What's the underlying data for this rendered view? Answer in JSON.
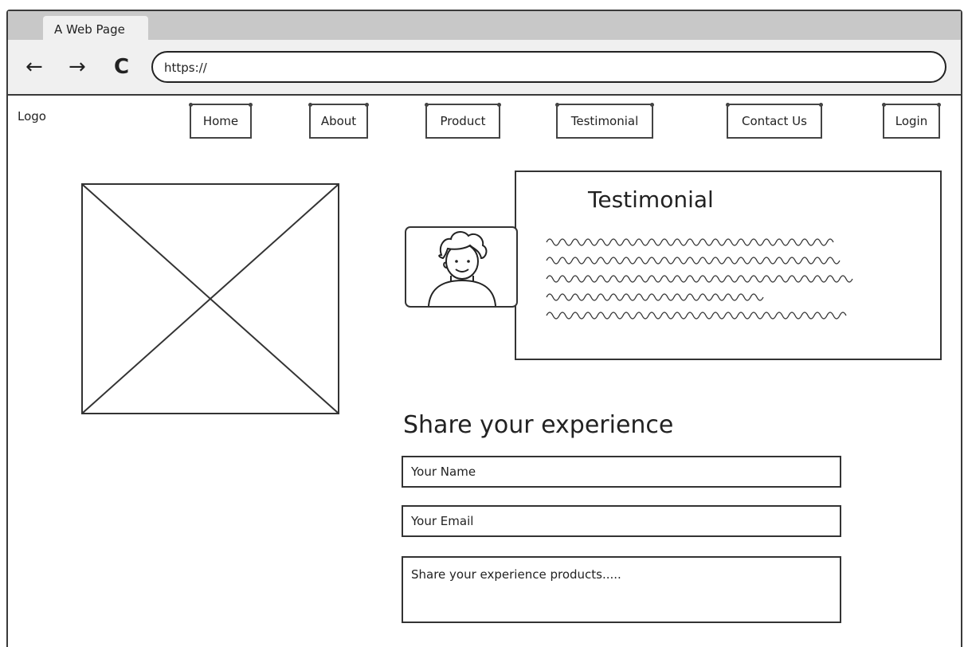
{
  "browser": {
    "tab_title": "A Web Page",
    "url": "https://",
    "back_icon": "←",
    "forward_icon": "→",
    "reload_icon": "C"
  },
  "header": {
    "logo": "Logo",
    "nav": [
      "Home",
      "About",
      "Product",
      "Testimonial",
      "Contact Us"
    ],
    "login": "Login"
  },
  "testimonial": {
    "title": "Testimonial"
  },
  "form": {
    "heading": "Share your experience",
    "name_placeholder": "Your Name",
    "email_placeholder": "Your Email",
    "message_placeholder": "Share your experience products....."
  }
}
